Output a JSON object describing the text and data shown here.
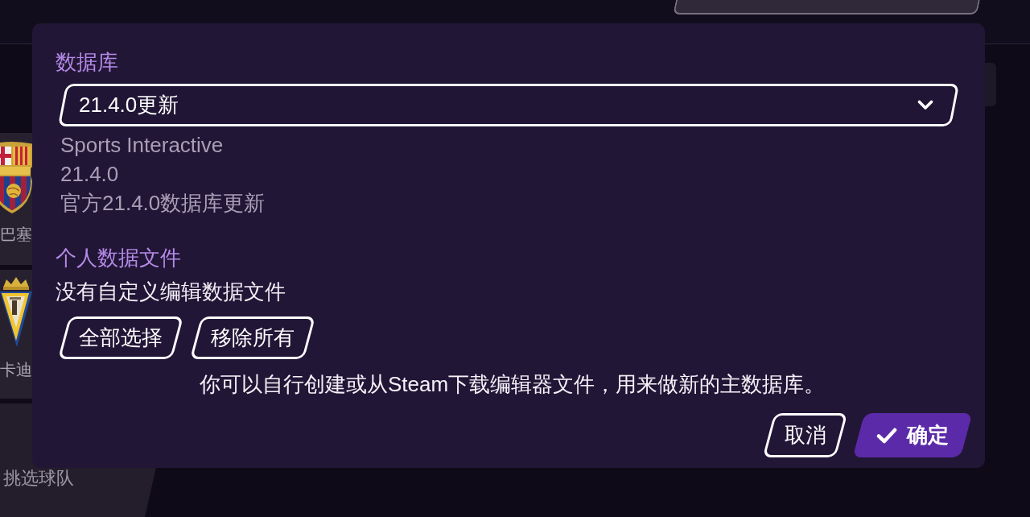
{
  "background": {
    "teams": [
      {
        "name": "巴塞",
        "kind": "stripes"
      },
      {
        "name": "卡迪",
        "kind": "triangle"
      }
    ],
    "prompt": "挑选球队"
  },
  "dialog": {
    "database": {
      "heading": "数据库",
      "dropdown": {
        "value": "21.4.0更新"
      },
      "details": [
        "Sports Interactive",
        "21.4.0",
        "官方21.4.0数据库更新"
      ]
    },
    "personal_files": {
      "heading": "个人数据文件",
      "status": "没有自定义编辑数据文件",
      "buttons": [
        {
          "label": "全部选择"
        },
        {
          "label": "移除所有"
        }
      ]
    },
    "hint": "你可以自行创建或从Steam下载编辑器文件，用来做新的主数据库。",
    "actions": [
      {
        "label": "取消",
        "kind": "secondary"
      },
      {
        "label": "确定",
        "kind": "primary"
      }
    ]
  }
}
